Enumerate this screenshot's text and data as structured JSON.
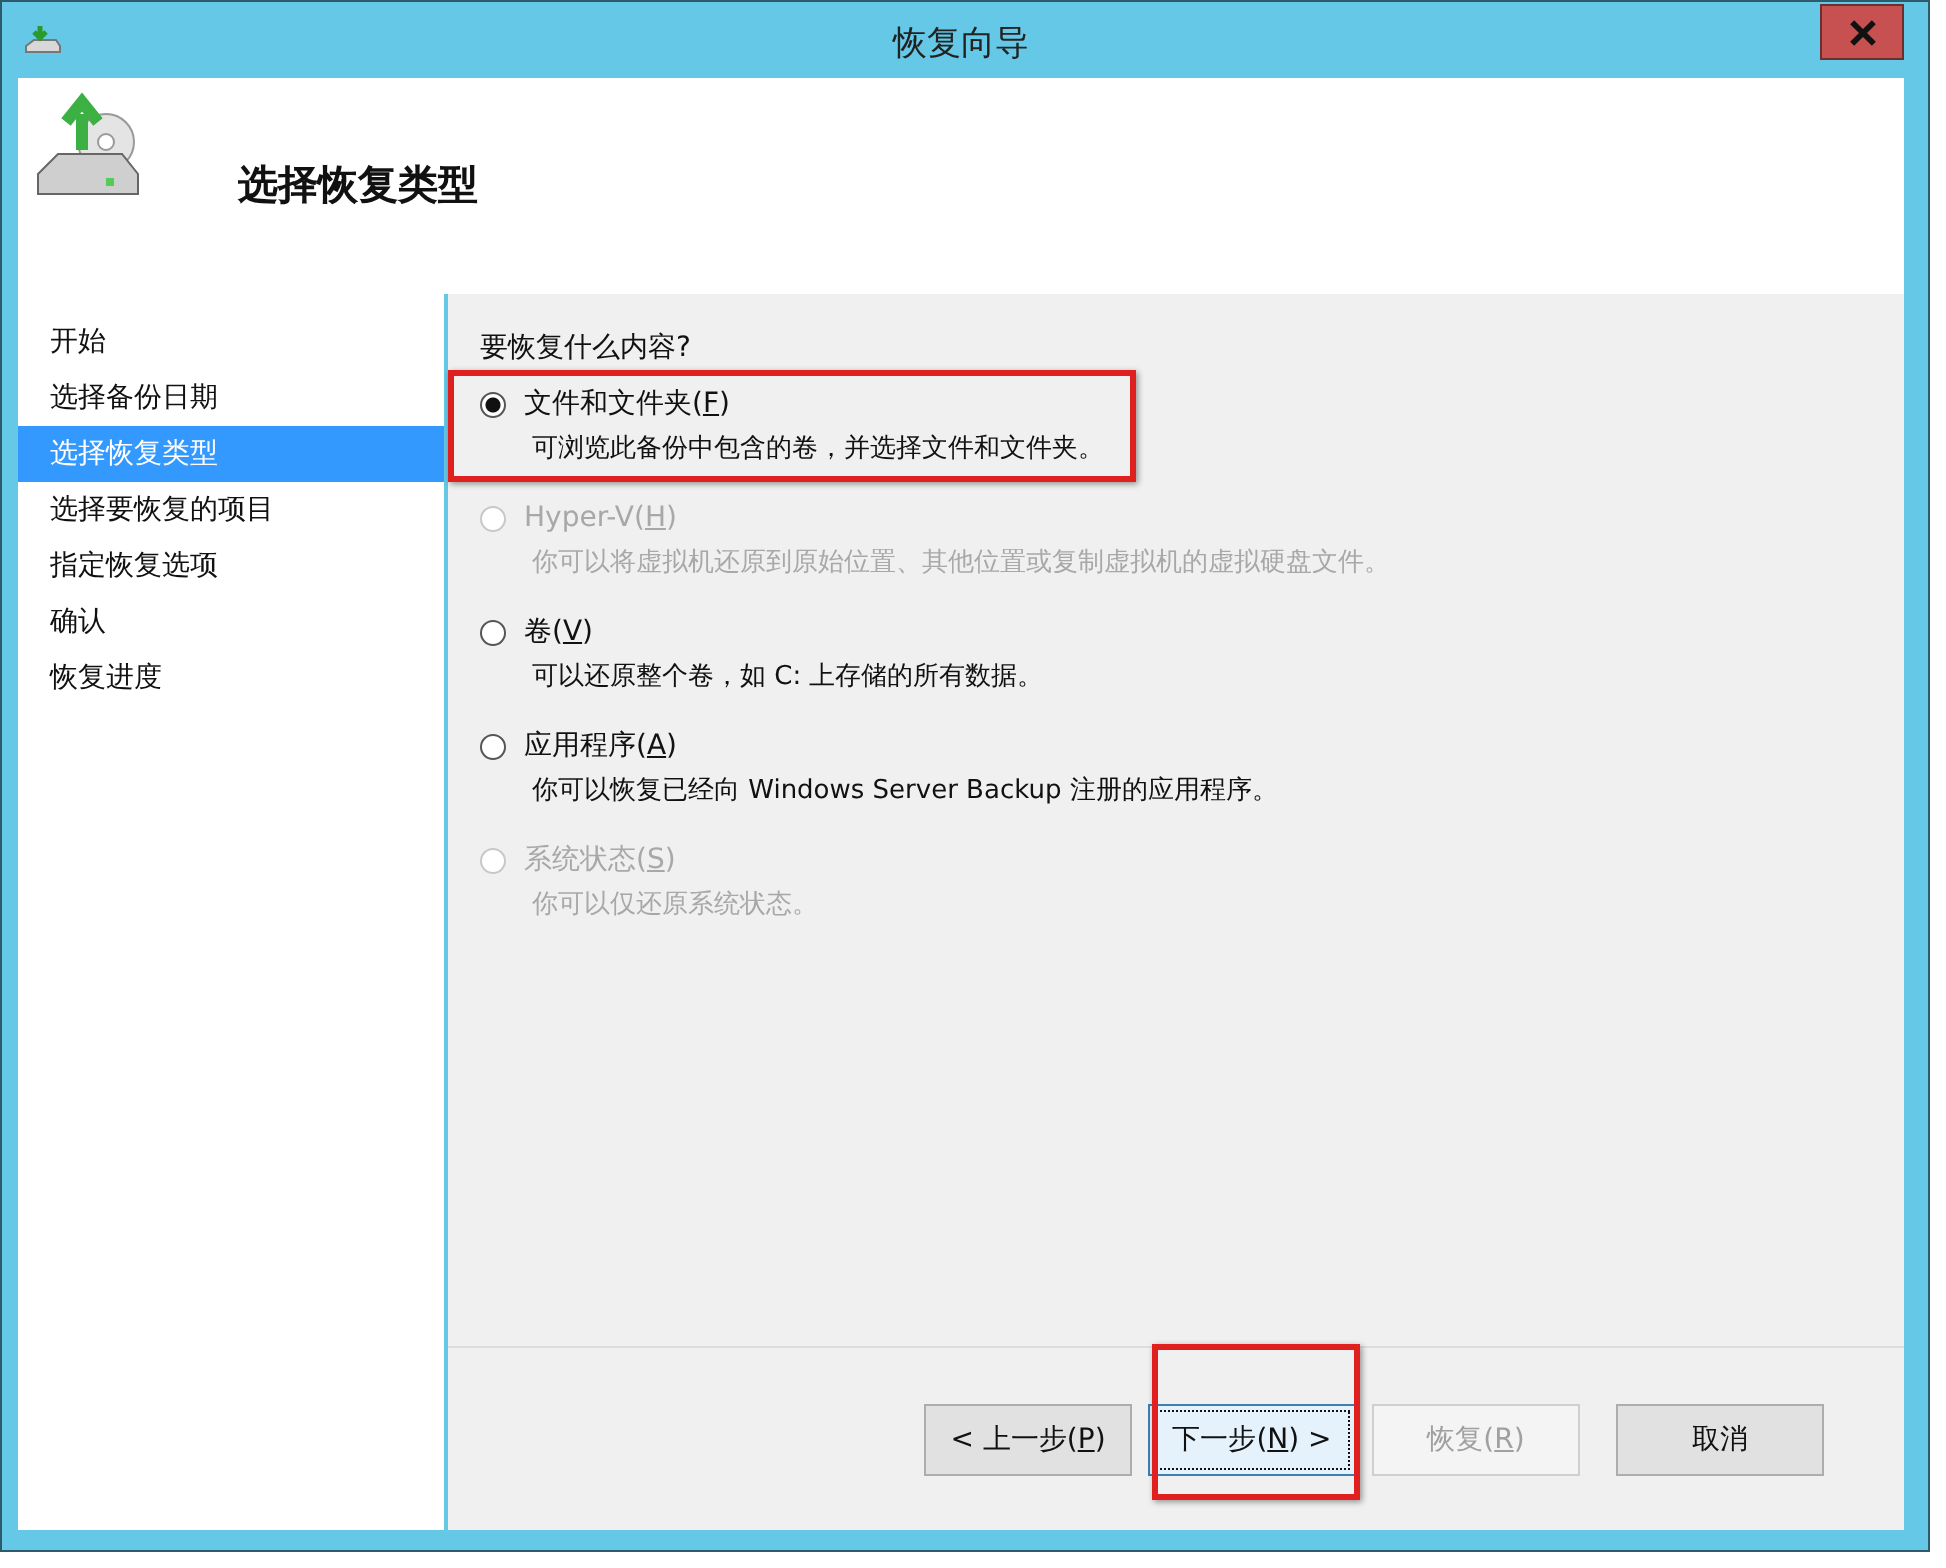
{
  "window": {
    "title": "恢复向导"
  },
  "header": {
    "title": "选择恢复类型"
  },
  "sidebar": {
    "items": [
      {
        "label": "开始",
        "selected": false
      },
      {
        "label": "选择备份日期",
        "selected": false
      },
      {
        "label": "选择恢复类型",
        "selected": true
      },
      {
        "label": "选择要恢复的项目",
        "selected": false
      },
      {
        "label": "指定恢复选项",
        "selected": false
      },
      {
        "label": "确认",
        "selected": false
      },
      {
        "label": "恢复进度",
        "selected": false
      }
    ]
  },
  "question": "要恢复什么内容?",
  "options": [
    {
      "label": "文件和文件夹(",
      "key": "F",
      "label_end": ")",
      "description": "可浏览此备份中包含的卷，并选择文件和文件夹。",
      "selected": true,
      "disabled": false,
      "highlighted": true
    },
    {
      "label": "Hyper-V(",
      "key": "H",
      "label_end": ")",
      "description": "你可以将虚拟机还原到原始位置、其他位置或复制虚拟机的虚拟硬盘文件。",
      "selected": false,
      "disabled": true,
      "highlighted": false
    },
    {
      "label": "卷(",
      "key": "V",
      "label_end": ")",
      "description": "可以还原整个卷，如 C: 上存储的所有数据。",
      "selected": false,
      "disabled": false,
      "highlighted": false
    },
    {
      "label": "应用程序(",
      "key": "A",
      "label_end": ")",
      "description": "你可以恢复已经向 Windows Server Backup 注册的应用程序。",
      "selected": false,
      "disabled": false,
      "highlighted": false
    },
    {
      "label": "系统状态(",
      "key": "S",
      "label_end": ")",
      "description": "你可以仅还原系统状态。",
      "selected": false,
      "disabled": true,
      "highlighted": false
    }
  ],
  "buttons": [
    {
      "label": "< 上一步(",
      "key": "P",
      "label_end": ")",
      "disabled": false,
      "focused": false,
      "highlighted": false
    },
    {
      "label": "下一步(",
      "key": "N",
      "label_end": ") >",
      "disabled": false,
      "focused": true,
      "highlighted": true
    },
    {
      "label": "恢复(",
      "key": "R",
      "label_end": ")",
      "disabled": true,
      "focused": false,
      "highlighted": false
    },
    {
      "label": "取消",
      "disabled": false,
      "focused": false,
      "highlighted": false
    }
  ]
}
